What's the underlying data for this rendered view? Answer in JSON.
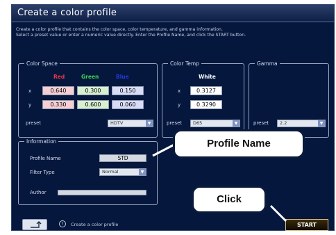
{
  "window": {
    "title": "Create a color profile",
    "description_line1": "Create a color profile that contains the color space, color temperature, and gamma information.",
    "description_line2": "Select a preset value or enter a numeric value directly. Enter the Profile Name, and click the START button."
  },
  "color_space": {
    "legend": "Color Space",
    "headers": {
      "red": "Red",
      "green": "Green",
      "blue": "Blue"
    },
    "x_label": "x",
    "y_label": "y",
    "x_values": {
      "red": "0.640",
      "green": "0.300",
      "blue": "0.150"
    },
    "y_values": {
      "red": "0.330",
      "green": "0.600",
      "blue": "0.060"
    },
    "preset_label": "preset",
    "preset_value": "HDTV"
  },
  "color_temp": {
    "legend": "Color Temp",
    "header": "White",
    "x_label": "x",
    "y_label": "y",
    "x_value": "0.3127",
    "y_value": "0.3290",
    "preset_label": "preset",
    "preset_value": "D65"
  },
  "gamma": {
    "legend": "Gamma",
    "preset_label": "preset",
    "preset_value": "2.2"
  },
  "information": {
    "legend": "Information",
    "profile_name_label": "Profile Name",
    "profile_name_value": "STD",
    "filter_type_label": "Filter Type",
    "filter_type_value": "Normal",
    "author_label": "Author",
    "author_value": ""
  },
  "status_bar": {
    "status_text": "Create a color profile",
    "start_label": "START"
  },
  "callouts": {
    "profile_name": "Profile Name",
    "click": "Click"
  },
  "colors": {
    "background": "#05173d",
    "red_header": "#e8384a",
    "green_header": "#3dd24f",
    "blue_header": "#2438e0",
    "callout_line": "#ffffff"
  }
}
